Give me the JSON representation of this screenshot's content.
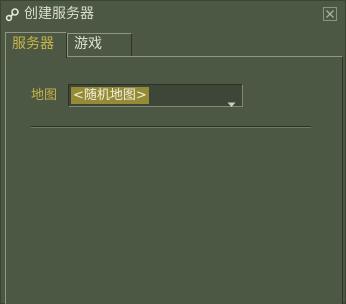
{
  "window": {
    "title": "创建服务器",
    "icon": "steam-icon",
    "close_icon": "close-icon"
  },
  "tabs": [
    {
      "label": "服务器",
      "active": true
    },
    {
      "label": "游戏",
      "active": false
    }
  ],
  "server_tab": {
    "map_label": "地图",
    "map_select": {
      "selected": "<随机地图>"
    }
  },
  "colors": {
    "background": "#4c5844",
    "accent_text": "#c7b44a",
    "selection": "#958a35",
    "text": "#dde2ce"
  }
}
